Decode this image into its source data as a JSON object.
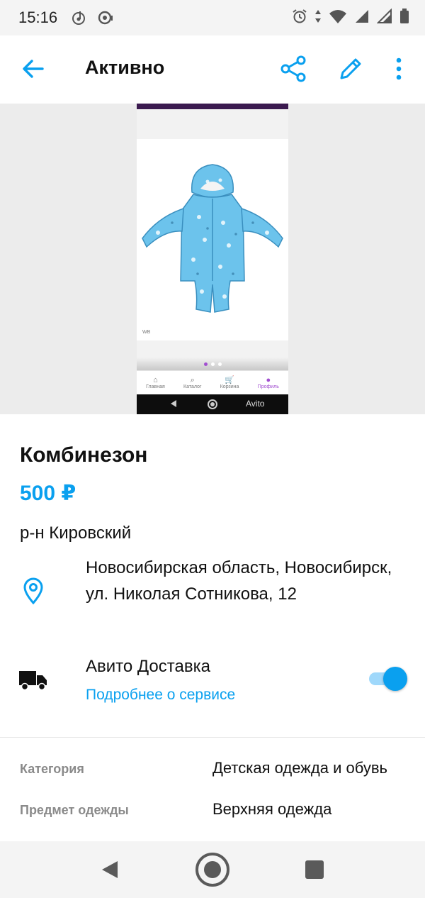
{
  "status_bar": {
    "time": "15:16"
  },
  "app_bar": {
    "title": "Активно"
  },
  "gallery": {
    "tabs": [
      "Главная",
      "Каталог",
      "Корзина",
      "Профиль"
    ],
    "active_tab": "Профиль",
    "watermark": "Avito",
    "image_caption": "WB"
  },
  "listing": {
    "title": "Комбинезон",
    "price": "500 ₽",
    "district": "р-н Кировский",
    "address": "Новосибирская область, Новосибирск, ул. Николая Сотникова, 12"
  },
  "delivery": {
    "title": "Авито Доставка",
    "link": "Подробнее о сервисе",
    "enabled": true
  },
  "params": [
    {
      "key": "Категория",
      "value": "Детская одежда и обувь"
    },
    {
      "key": "Предмет одежды",
      "value": "Верхняя одежда"
    }
  ],
  "colors": {
    "accent": "#0aa0ef",
    "purple": "#a24fd0",
    "garment": "#6cc3ec"
  }
}
